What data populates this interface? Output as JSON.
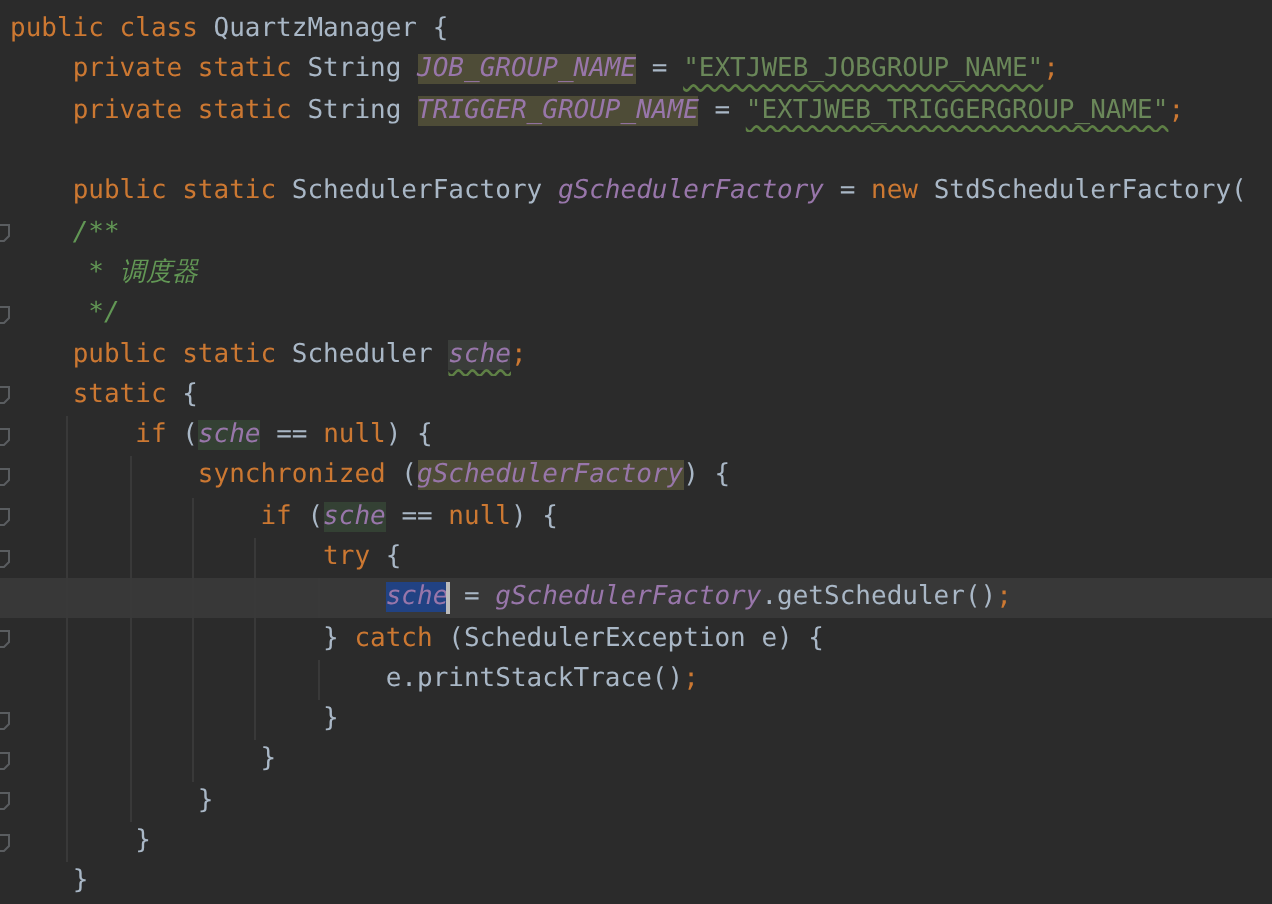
{
  "editor": {
    "lines": [
      {
        "kind": "code",
        "fold": false,
        "current": false,
        "tokens": [
          {
            "text": "public class ",
            "kind": "keyword"
          },
          {
            "text": "QuartzManager {",
            "kind": "plain"
          }
        ]
      },
      {
        "kind": "code",
        "fold": false,
        "current": false,
        "tokens": [
          {
            "text": "    private static ",
            "kind": "keyword"
          },
          {
            "text": "String ",
            "kind": "plain"
          },
          {
            "text": "JOB_GROUP_NAME",
            "kind": "warned"
          },
          {
            "text": " = ",
            "kind": "plain"
          },
          {
            "text": "\"EXTJWEB_JOBGROUP_NAME\"",
            "kind": "flagged"
          },
          {
            "text": ";",
            "kind": "punct"
          }
        ]
      },
      {
        "kind": "code",
        "fold": false,
        "current": false,
        "tokens": [
          {
            "text": "    private static ",
            "kind": "keyword"
          },
          {
            "text": "String ",
            "kind": "plain"
          },
          {
            "text": "TRIGGER_GROUP_NAME",
            "kind": "warned"
          },
          {
            "text": " = ",
            "kind": "plain"
          },
          {
            "text": "\"EXTJWEB_TRIGGERGROUP_NAME\"",
            "kind": "flagged"
          },
          {
            "text": ";",
            "kind": "punct"
          }
        ]
      },
      {
        "kind": "blank",
        "fold": false,
        "current": false
      },
      {
        "kind": "code",
        "fold": false,
        "current": false,
        "tokens": [
          {
            "text": "    public static ",
            "kind": "keyword"
          },
          {
            "text": "SchedulerFactory ",
            "kind": "plain"
          },
          {
            "text": "gSchedulerFactory",
            "kind": "field"
          },
          {
            "text": " = ",
            "kind": "plain"
          },
          {
            "text": "new ",
            "kind": "keyword"
          },
          {
            "text": "StdSchedulerFactory(",
            "kind": "plain"
          }
        ]
      },
      {
        "kind": "code",
        "fold": true,
        "current": false,
        "tokens": [
          {
            "text": "    /**",
            "kind": "comment"
          }
        ]
      },
      {
        "kind": "code",
        "fold": false,
        "current": false,
        "tokens": [
          {
            "text": "     * 调度器",
            "kind": "comment"
          }
        ]
      },
      {
        "kind": "code",
        "fold": true,
        "current": false,
        "tokens": [
          {
            "text": "     */",
            "kind": "comment"
          }
        ]
      },
      {
        "kind": "code",
        "fold": false,
        "current": false,
        "tokens": [
          {
            "text": "    public static ",
            "kind": "keyword"
          },
          {
            "text": "Scheduler ",
            "kind": "plain"
          },
          {
            "text": "sche",
            "kind": "declared"
          },
          {
            "text": ";",
            "kind": "punct"
          }
        ]
      },
      {
        "kind": "code",
        "fold": true,
        "current": false,
        "tokens": [
          {
            "text": "    static ",
            "kind": "keyword"
          },
          {
            "text": "{",
            "kind": "plain"
          }
        ]
      },
      {
        "kind": "code",
        "fold": true,
        "current": false,
        "tokens": [
          {
            "text": "        if ",
            "kind": "keyword"
          },
          {
            "text": "(",
            "kind": "plain"
          },
          {
            "text": "sche",
            "kind": "used"
          },
          {
            "text": " == ",
            "kind": "plain"
          },
          {
            "text": "null",
            "kind": "keyword"
          },
          {
            "text": ") {",
            "kind": "plain"
          }
        ]
      },
      {
        "kind": "code",
        "fold": true,
        "current": false,
        "tokens": [
          {
            "text": "            synchronized ",
            "kind": "keyword"
          },
          {
            "text": "(",
            "kind": "plain"
          },
          {
            "text": "gSchedulerFactory",
            "kind": "warned"
          },
          {
            "text": ") {",
            "kind": "plain"
          }
        ]
      },
      {
        "kind": "code",
        "fold": true,
        "current": false,
        "tokens": [
          {
            "text": "                if ",
            "kind": "keyword"
          },
          {
            "text": "(",
            "kind": "plain"
          },
          {
            "text": "sche",
            "kind": "used"
          },
          {
            "text": " == ",
            "kind": "plain"
          },
          {
            "text": "null",
            "kind": "keyword"
          },
          {
            "text": ") {",
            "kind": "plain"
          }
        ]
      },
      {
        "kind": "code",
        "fold": true,
        "current": false,
        "tokens": [
          {
            "text": "                    try ",
            "kind": "keyword"
          },
          {
            "text": "{",
            "kind": "plain"
          }
        ]
      },
      {
        "kind": "code",
        "fold": false,
        "current": true,
        "tokens": [
          {
            "text": "                        sche",
            "kind": "highlighted"
          },
          {
            "kind": "caret"
          },
          {
            "text": " = ",
            "kind": "plain"
          },
          {
            "text": "gSchedulerFactory",
            "kind": "field"
          },
          {
            "text": ".getScheduler()",
            "kind": "plain"
          },
          {
            "text": ";",
            "kind": "punct"
          }
        ]
      },
      {
        "kind": "code",
        "fold": true,
        "current": false,
        "tokens": [
          {
            "text": "                    } ",
            "kind": "plain"
          },
          {
            "text": "catch ",
            "kind": "keyword"
          },
          {
            "text": "(SchedulerException e) {",
            "kind": "plain"
          }
        ]
      },
      {
        "kind": "code",
        "fold": false,
        "current": false,
        "tokens": [
          {
            "text": "                        e.printStackTrace()",
            "kind": "plain"
          },
          {
            "text": ";",
            "kind": "punct"
          }
        ]
      },
      {
        "kind": "code",
        "fold": true,
        "current": false,
        "tokens": [
          {
            "text": "                    }",
            "kind": "plain"
          }
        ]
      },
      {
        "kind": "code",
        "fold": true,
        "current": false,
        "tokens": [
          {
            "text": "                }",
            "kind": "plain"
          }
        ]
      },
      {
        "kind": "code",
        "fold": true,
        "current": false,
        "tokens": [
          {
            "text": "            }",
            "kind": "plain"
          }
        ]
      },
      {
        "kind": "code",
        "fold": true,
        "current": false,
        "tokens": [
          {
            "text": "        }",
            "kind": "plain"
          }
        ]
      },
      {
        "kind": "code",
        "fold": false,
        "current": false,
        "tokens": [
          {
            "text": "    }",
            "kind": "plain"
          }
        ]
      }
    ]
  }
}
